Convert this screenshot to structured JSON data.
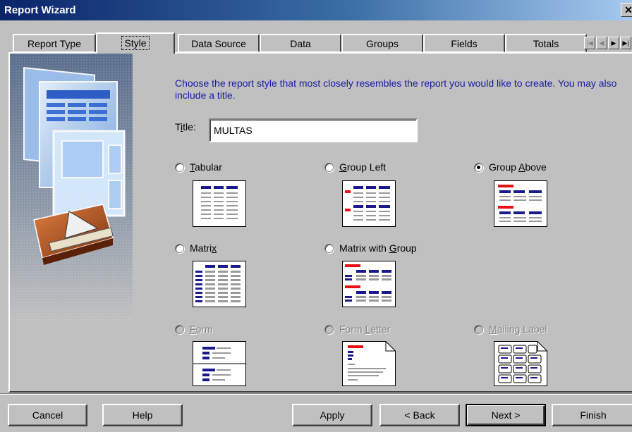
{
  "window": {
    "title": "Report Wizard",
    "close_glyph": "✕"
  },
  "tabs": [
    "Report Type",
    "Style",
    "Data Source",
    "Data",
    "Groups",
    "Fields",
    "Totals"
  ],
  "active_tab": "Style",
  "instructions": "Choose the report style that most closely resembles the report you would like to create. You may also include a title.",
  "title_field": {
    "label": "Title:",
    "value": "MULTAS"
  },
  "styles": {
    "tabular": "Tabular",
    "group_left": "Group Left",
    "group_above": "Group Above",
    "matrix": "Matrix",
    "matrix_with_group": "Matrix with Group",
    "form": "Form",
    "form_letter": "Form Letter",
    "mailing_label": "Mailing Label",
    "selected": "Group Above"
  },
  "buttons": {
    "cancel": "Cancel",
    "help": "Help",
    "apply": "Apply",
    "back": "< Back",
    "next": "Next >",
    "finish": "Finish"
  },
  "colors": {
    "accent_blue": "#0a246a",
    "preview_red": "#e81010",
    "preview_blue": "#1a1a8c",
    "text_blue": "#1a1aa0"
  }
}
